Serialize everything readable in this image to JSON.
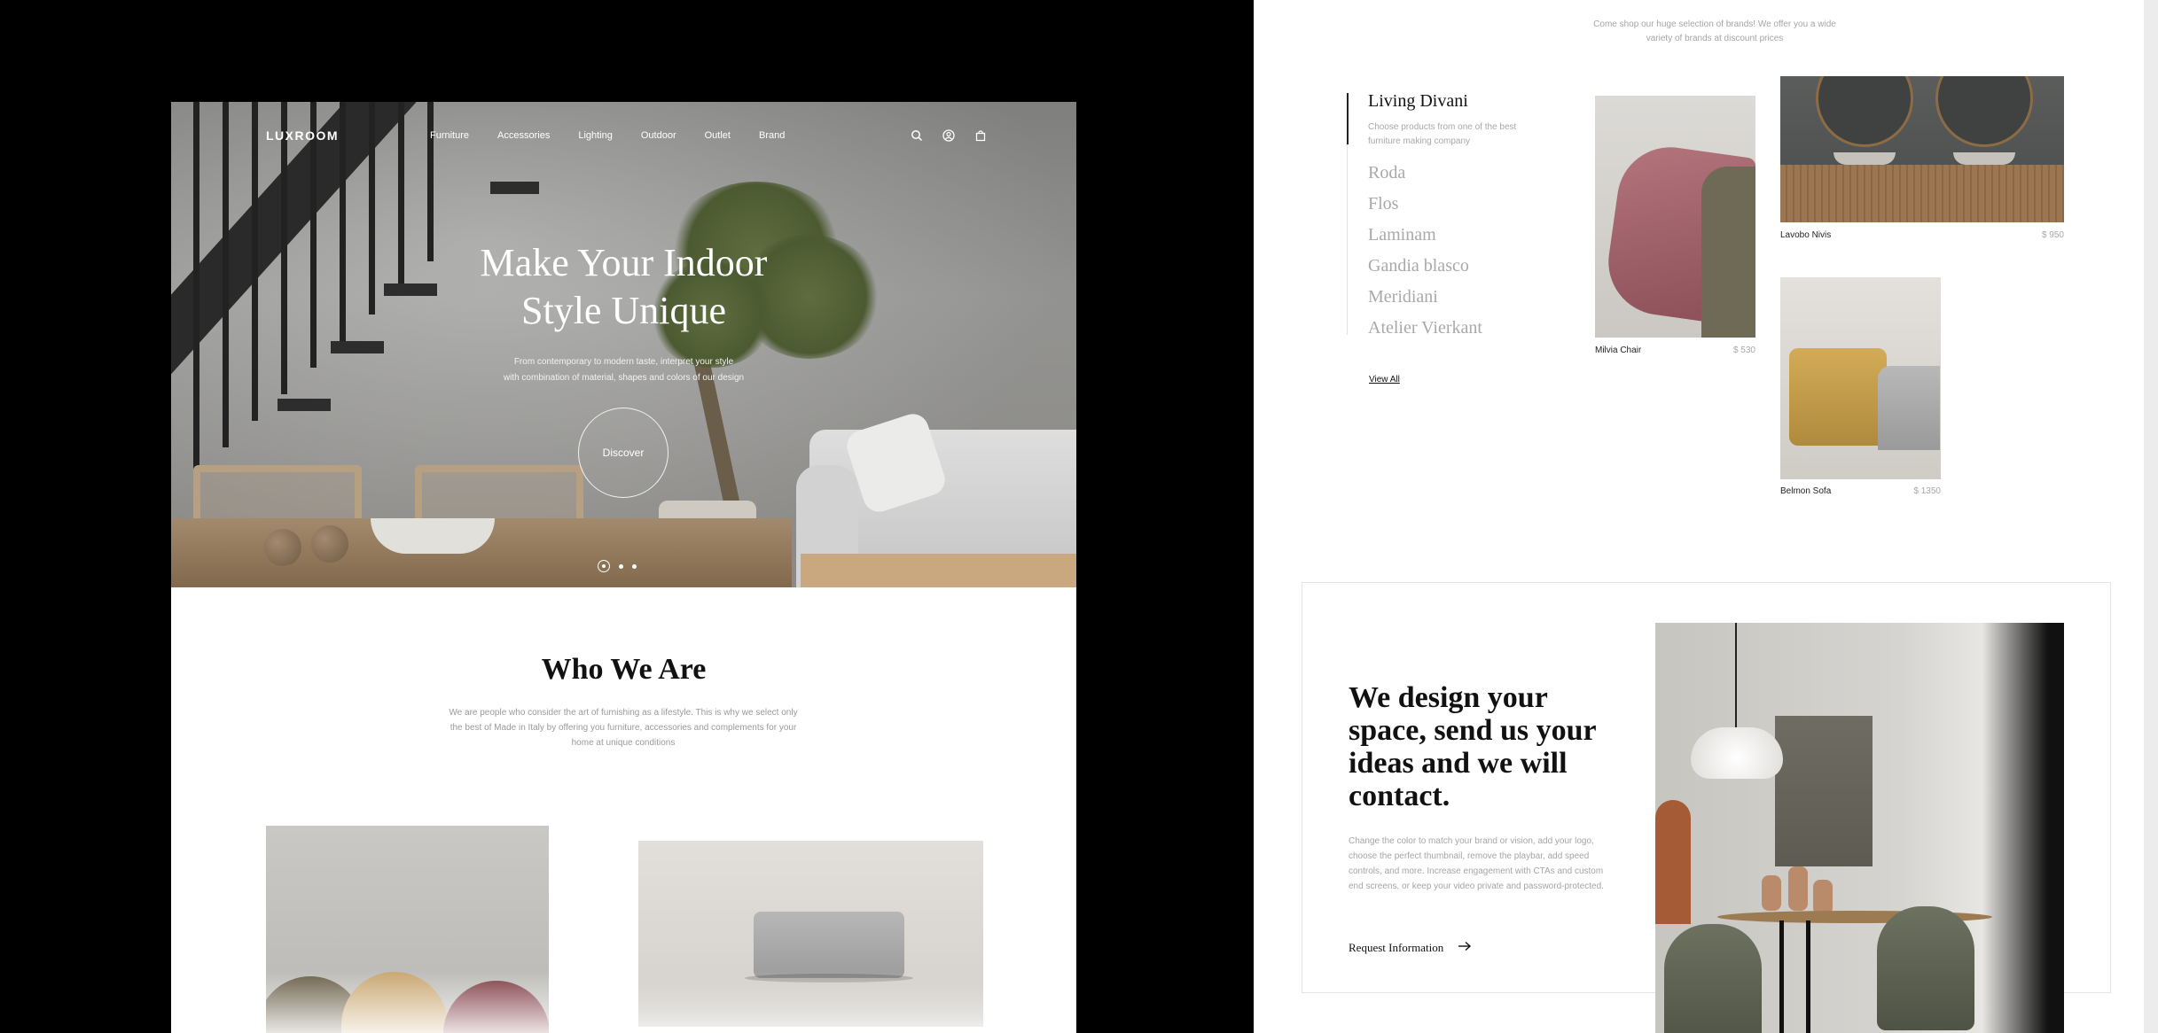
{
  "left": {
    "nav": {
      "logo": "LUXROOM",
      "links": [
        "Furniture",
        "Accessories",
        "Lighting",
        "Outdoor",
        "Outlet",
        "Brand"
      ],
      "icons": [
        "search-icon",
        "user-icon",
        "cart-icon"
      ]
    },
    "hero": {
      "title_line1": "Make Your Indoor",
      "title_line2": "Style Unique",
      "subtitle_line1": "From contemporary to modern taste, interpret your style",
      "subtitle_line2": "with combination of material, shapes and colors of our design",
      "cta": "Discover",
      "slides": 3,
      "active_slide": 1
    },
    "who": {
      "title": "Who We Are",
      "text": "We are people who consider the art of furnishing as a lifestyle. This is why we select only the best of Made in Italy by offering you furniture, accessories and complements for your home at unique conditions"
    }
  },
  "right": {
    "intro_text": "Come shop our huge selection of brands! We offer you a wide variety of brands at discount prices",
    "brands": {
      "title": "Living Divani",
      "description": "Choose products from one of the best furniture making company",
      "items": [
        "Roda",
        "Flos",
        "Laminam",
        "Gandia blasco",
        "Meridiani",
        "Atelier Vierkant"
      ],
      "view_all": "View All"
    },
    "products": [
      {
        "name": "Milvia Chair",
        "price": "$ 530"
      },
      {
        "name": "Lavobo Nivis",
        "price": "$ 950"
      },
      {
        "name": "Belmon Sofa",
        "price": "$ 1350"
      }
    ],
    "contact": {
      "title": "We design your space, send us your ideas and we will contact.",
      "text": "Change the color to match your brand or vision, add your logo, choose the perfect thumbnail, remove the playbar, add speed controls, and more. Increase engagement with CTAs and custom end screens, or keep your video private and password-protected.",
      "link": "Request Information"
    }
  },
  "colors": {
    "background": "#000000",
    "text_dark": "#111111",
    "text_muted": "#a5a5a5"
  }
}
